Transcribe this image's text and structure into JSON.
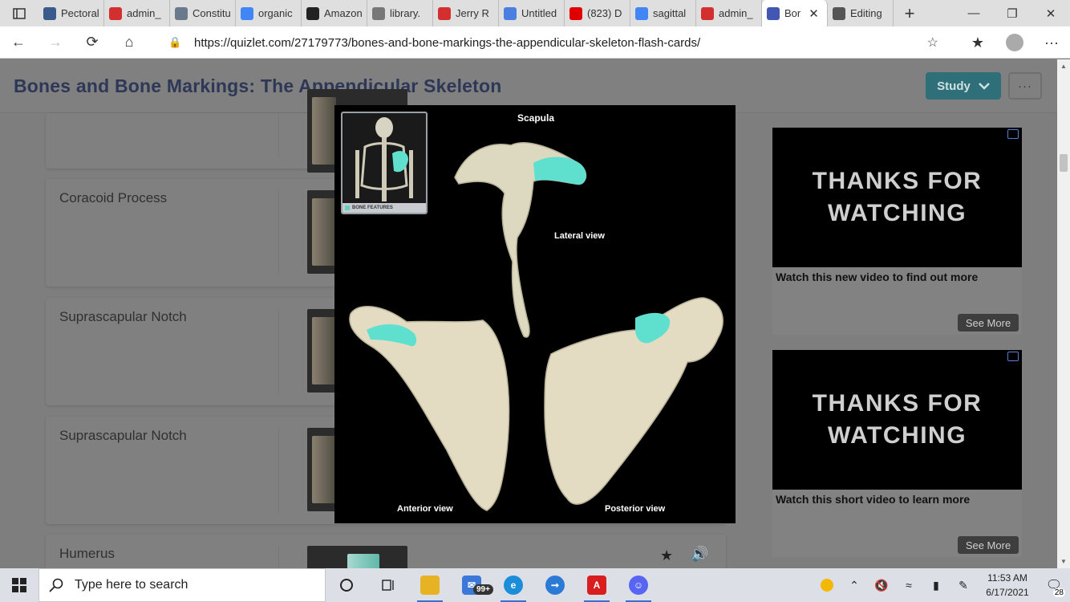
{
  "browser": {
    "tabs": [
      {
        "title": "Pectoral",
        "icon": "image-favicon",
        "color": "#3a5a8c",
        "width": 82
      },
      {
        "title": "admin_",
        "icon": "pdf-favicon",
        "color": "#d32f2f",
        "width": 82
      },
      {
        "title": "Constitu",
        "icon": "image-favicon",
        "color": "#6a7a8c",
        "width": 82
      },
      {
        "title": "organic",
        "icon": "google-favicon",
        "color": "#4285f4",
        "width": 82
      },
      {
        "title": "Amazon",
        "icon": "amazon-favicon",
        "color": "#222222",
        "width": 82
      },
      {
        "title": "library.",
        "icon": "document-favicon",
        "color": "#777777",
        "width": 82
      },
      {
        "title": "Jerry R",
        "icon": "pdf-favicon",
        "color": "#d32f2f",
        "width": 82
      },
      {
        "title": "Untitled",
        "icon": "docs-favicon",
        "color": "#4a7ee0",
        "width": 82
      },
      {
        "title": "(823) D",
        "icon": "youtube-favicon",
        "color": "#e00000",
        "width": 82
      },
      {
        "title": "sagittal",
        "icon": "google-favicon",
        "color": "#4285f4",
        "width": 82
      },
      {
        "title": "admin_",
        "icon": "pdf-favicon",
        "color": "#d32f2f",
        "width": 82
      },
      {
        "title": "Bor",
        "icon": "quizlet-favicon",
        "color": "#4257b2",
        "width": 82,
        "active": true
      },
      {
        "title": "Editing",
        "icon": "editing-favicon",
        "color": "#555555",
        "width": 82
      }
    ],
    "url": "https://quizlet.com/27179773/bones-and-bone-markings-the-appendicular-skeleton-flash-cards/"
  },
  "page": {
    "title": "Bones and Bone Markings: The Appendicular Skeleton",
    "study_label": "Study",
    "more_label": "···",
    "cards": [
      {
        "term": "Coracoid Process"
      },
      {
        "term": "Suprascapular Notch"
      },
      {
        "term": "Suprascapular Notch"
      },
      {
        "term": "Humerus"
      }
    ],
    "modal": {
      "title": "Scapula",
      "lateral_label": "Lateral view",
      "anterior_label": "Anterior view",
      "posterior_label": "Posterior view",
      "inset_caption": "BONE FEATURES"
    },
    "ads": [
      {
        "video_text": "THANKS FOR WATCHING",
        "description": "Watch this new video to find out more",
        "button": "See More"
      },
      {
        "video_text": "THANKS FOR WATCHING",
        "description": "Watch this short video to learn more",
        "button": "See More"
      }
    ]
  },
  "taskbar": {
    "search_placeholder": "Type here to search",
    "mail_badge": "99+",
    "time": "11:53 AM",
    "date": "6/17/2021",
    "notification_count": "28"
  }
}
